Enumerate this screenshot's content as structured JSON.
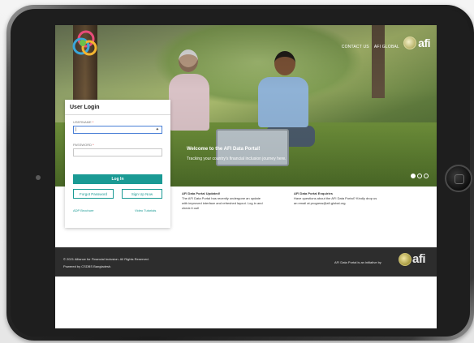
{
  "header": {
    "nav": [
      "CONTACT US",
      "AFI GLOBAL"
    ],
    "brand": "afi"
  },
  "login": {
    "title": "User Login",
    "username_label": "USERNAME",
    "password_label": "PASSWORD",
    "required_mark": "*",
    "username_value": "|",
    "login_button": "Log In",
    "forgot_button": "Forgot Password",
    "signup_button": "Sign Up Now",
    "brochure_link": "ADP Brochure",
    "tutorials_link": "Video Tutorials"
  },
  "hero": {
    "welcome": "Welcome to the AFI Data Portal!",
    "tagline": "Tracking your country's financial inclusion journey here."
  },
  "info": {
    "update_title": "AFI Data Portal Updated!",
    "update_body": [
      "The AFI Data Portal has recently undergone an update",
      "with improved interface and refreshed layout. Log in and",
      "check it out!"
    ],
    "enquiry_title": "AFI Data Portal Enquiries",
    "enquiry_body": [
      "Have questions about the AFI Data Portal? Kindly drop us",
      "an email at progress@afi-global.org."
    ]
  },
  "footer": {
    "copyright": "© 2021 Alliance for Financial Inclusion. All Rights Reserved.",
    "powered": "Powered by CSDBS Bangladesh.",
    "initiative": "AFI Data Portal is an initiative by",
    "brand": "afi"
  },
  "colors": {
    "accent": "#1a9a94",
    "footer_bg": "#2d2d2d"
  },
  "carousel": {
    "slides": 3,
    "active": 1
  }
}
